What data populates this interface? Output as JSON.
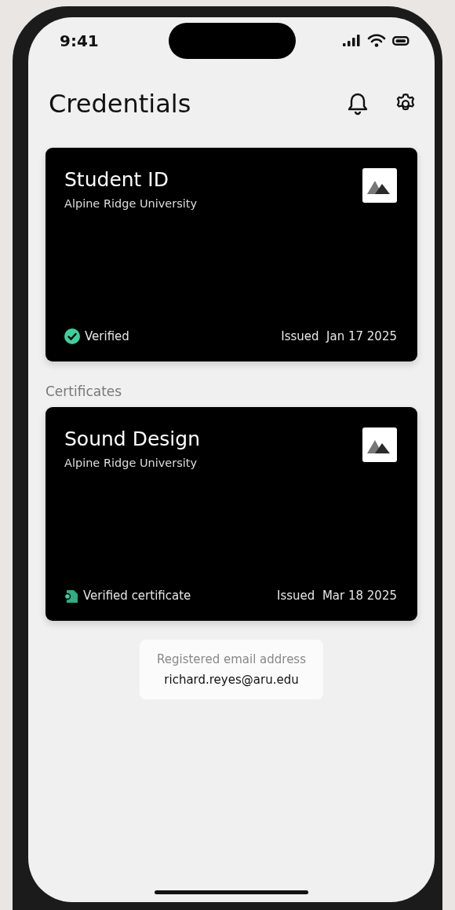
{
  "status_bar": {
    "time": "9:41"
  },
  "header": {
    "title": "Credentials"
  },
  "cards": [
    {
      "title": "Student ID",
      "issuer": "Alpine Ridge University",
      "kind": "check",
      "badge": "Verified",
      "issued_label": "Issued",
      "issued_date": "Jan  17  2025"
    },
    {
      "section": "Certificates",
      "title": "Sound Design",
      "issuer": "Alpine Ridge University",
      "kind": "certificate",
      "badge": "Verified certificate",
      "issued_label": "Issued",
      "issued_date": "Mar 18  2025"
    }
  ],
  "email": {
    "label": "Registered email address",
    "value": "richard.reyes@aru.edu"
  }
}
